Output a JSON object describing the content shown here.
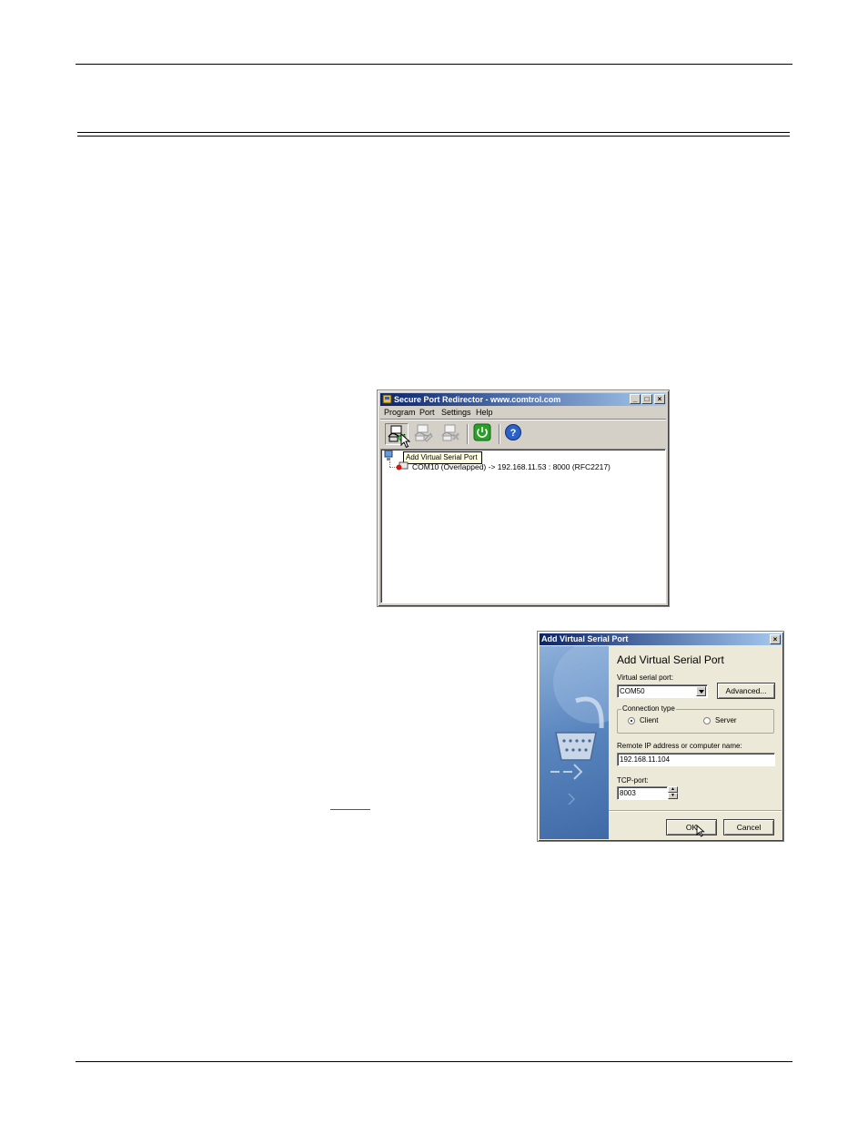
{
  "window1": {
    "title": "Secure Port Redirector - www.comtrol.com",
    "controls": {
      "minimize": "_",
      "maximize": "□",
      "close": "×"
    },
    "menu": [
      "Program",
      "Port",
      "Settings",
      "Help"
    ],
    "toolbar_icons": [
      "add-port-icon",
      "edit-port-icon",
      "remove-port-icon",
      "power-icon",
      "help-icon"
    ],
    "tooltip": "Add Virtual Serial Port",
    "tree": {
      "port_entry": "COM10 (Overlapped) -> 192.168.11.53 : 8000 (RFC2217)"
    }
  },
  "dialog": {
    "title": "Add Virtual Serial Port",
    "close": "×",
    "heading": "Add Virtual Serial Port",
    "virtual_port_label": "Virtual serial port:",
    "virtual_port_value": "COM50",
    "advanced_label": "Advanced...",
    "connection_type_label": "Connection type",
    "client_label": "Client",
    "server_label": "Server",
    "client_selected": true,
    "remote_label": "Remote IP address or computer name:",
    "remote_value": "192.168.11.104",
    "tcp_label": "TCP-port:",
    "tcp_value": "8003",
    "ok_label": "OK",
    "cancel_label": "Cancel"
  }
}
